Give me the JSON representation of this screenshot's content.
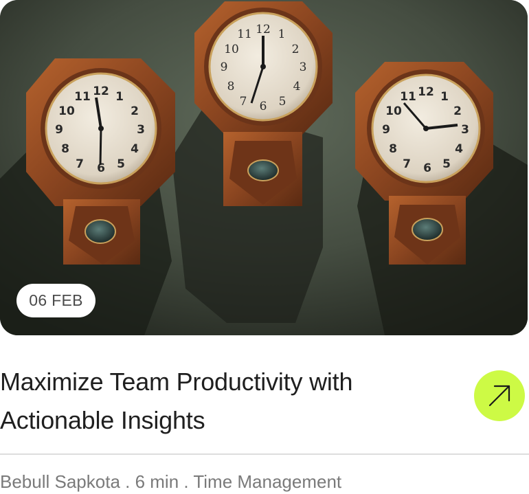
{
  "card": {
    "image_alt": "Three wooden wall clocks on a green wall",
    "date": "06 FEB",
    "title": "Maximize Team Productivity with Actionable Insights",
    "action_icon": "arrow-up-right-icon",
    "meta": {
      "author": "Bebull Sapkota",
      "separator": " . ",
      "read_time": "6 min",
      "category": "Time Management"
    }
  },
  "colors": {
    "accent": "#cdfa45",
    "title_text": "#1f1f1f",
    "meta_text": "#7a7a7a",
    "divider": "#dddddd"
  }
}
